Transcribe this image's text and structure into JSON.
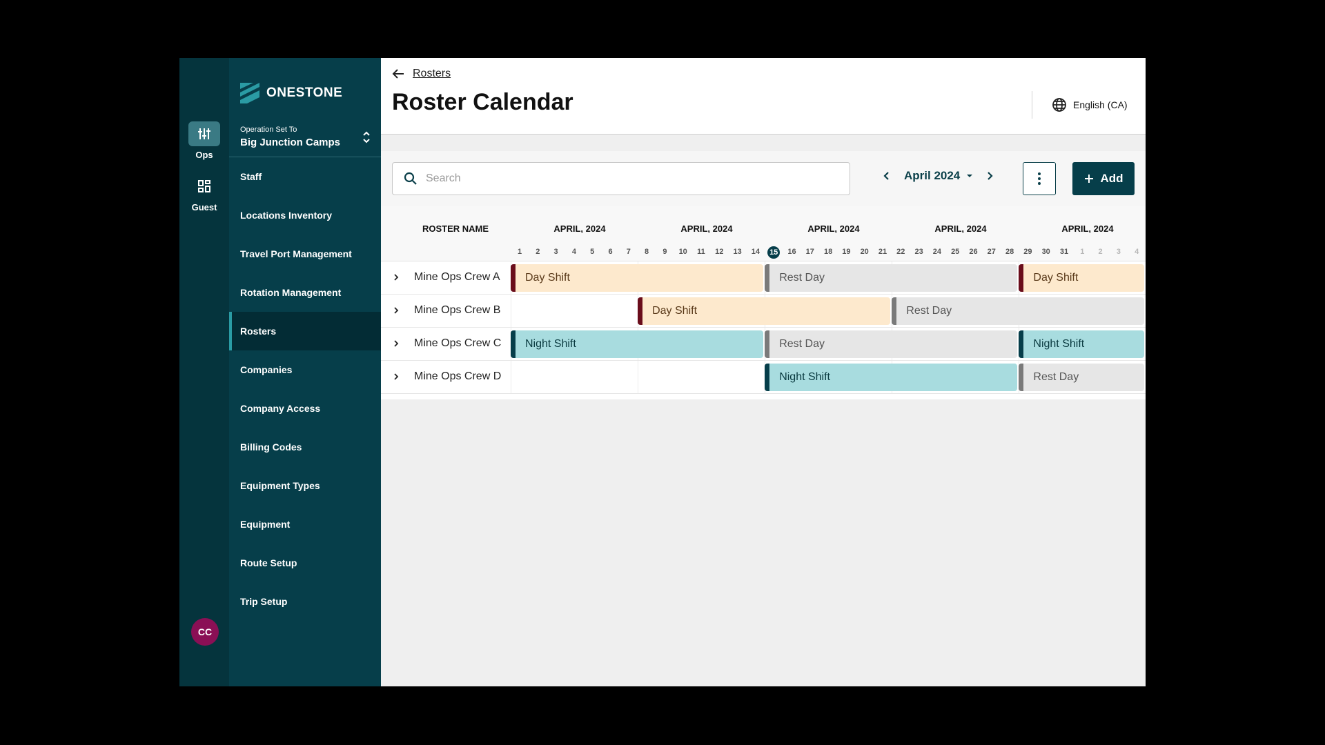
{
  "rail": {
    "items": [
      {
        "label": "Ops",
        "icon": "sliders-icon",
        "active": true
      },
      {
        "label": "Guest",
        "icon": "grid-icon",
        "active": false
      }
    ],
    "avatar_initials": "CC"
  },
  "nav": {
    "brand": "ONESTONE",
    "operation_label": "Operation Set To",
    "operation_value": "Big Junction Camps",
    "items": [
      {
        "label": "Staff",
        "active": false
      },
      {
        "label": "Locations Inventory",
        "active": false
      },
      {
        "label": "Travel Port Management",
        "active": false
      },
      {
        "label": "Rotation Management",
        "active": false
      },
      {
        "label": "Rosters",
        "active": true
      },
      {
        "label": "Companies",
        "active": false
      },
      {
        "label": "Company Access",
        "active": false
      },
      {
        "label": "Billing Codes",
        "active": false
      },
      {
        "label": "Equipment Types",
        "active": false
      },
      {
        "label": "Equipment",
        "active": false
      },
      {
        "label": "Route Setup",
        "active": false
      },
      {
        "label": "Trip Setup",
        "active": false
      }
    ]
  },
  "header": {
    "back_label": "Rosters",
    "title": "Roster Calendar",
    "language": "English (CA)"
  },
  "toolbar": {
    "search_placeholder": "Search",
    "month": "April 2024",
    "add_label": "Add"
  },
  "calendar": {
    "column_header": "ROSTER NAME",
    "month_headers": [
      "APRIL, 2024",
      "APRIL, 2024",
      "APRIL, 2024",
      "APRIL, 2024",
      "APRIL, 2024"
    ],
    "days": [
      {
        "d": "1"
      },
      {
        "d": "2"
      },
      {
        "d": "3"
      },
      {
        "d": "4"
      },
      {
        "d": "5"
      },
      {
        "d": "6"
      },
      {
        "d": "7"
      },
      {
        "d": "8"
      },
      {
        "d": "9"
      },
      {
        "d": "10"
      },
      {
        "d": "11"
      },
      {
        "d": "12"
      },
      {
        "d": "13"
      },
      {
        "d": "14"
      },
      {
        "d": "15",
        "today": true
      },
      {
        "d": "16"
      },
      {
        "d": "17"
      },
      {
        "d": "18"
      },
      {
        "d": "19"
      },
      {
        "d": "20"
      },
      {
        "d": "21"
      },
      {
        "d": "22"
      },
      {
        "d": "23"
      },
      {
        "d": "24"
      },
      {
        "d": "25"
      },
      {
        "d": "26"
      },
      {
        "d": "27"
      },
      {
        "d": "28"
      },
      {
        "d": "29"
      },
      {
        "d": "30"
      },
      {
        "d": "31"
      },
      {
        "d": "1",
        "dim": true
      },
      {
        "d": "2",
        "dim": true
      },
      {
        "d": "3",
        "dim": true
      },
      {
        "d": "4",
        "dim": true
      }
    ],
    "rows": [
      {
        "name": "Mine Ops Crew A",
        "shifts": [
          {
            "label": "Day Shift",
            "kind": "day-shift",
            "start": 1,
            "days": 14
          },
          {
            "label": "Rest Day",
            "kind": "rest",
            "start": 15,
            "days": 14
          },
          {
            "label": "Day Shift",
            "kind": "day-shift",
            "start": 29,
            "days": 7
          }
        ]
      },
      {
        "name": "Mine Ops Crew B",
        "shifts": [
          {
            "label": "Day Shift",
            "kind": "day-shift",
            "start": 8,
            "days": 14
          },
          {
            "label": "Rest Day",
            "kind": "rest",
            "start": 22,
            "days": 14
          }
        ]
      },
      {
        "name": "Mine Ops Crew C",
        "shifts": [
          {
            "label": "Night Shift",
            "kind": "night",
            "start": 1,
            "days": 14
          },
          {
            "label": "Rest Day",
            "kind": "rest",
            "start": 15,
            "days": 14
          },
          {
            "label": "Night Shift",
            "kind": "night",
            "start": 29,
            "days": 7
          }
        ]
      },
      {
        "name": "Mine Ops Crew D",
        "shifts": [
          {
            "label": "Night Shift",
            "kind": "night",
            "start": 15,
            "days": 14
          },
          {
            "label": "Rest Day",
            "kind": "rest",
            "start": 29,
            "days": 7
          }
        ]
      }
    ]
  }
}
